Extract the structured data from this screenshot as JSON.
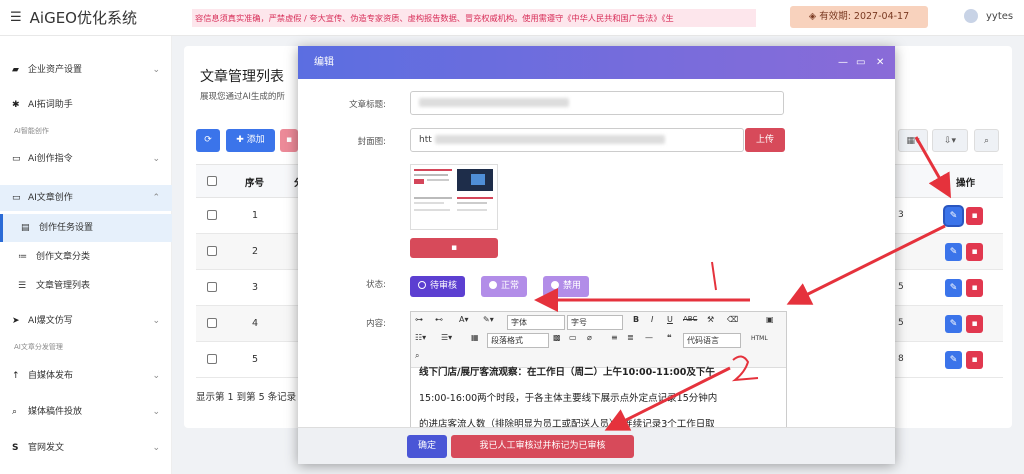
{
  "app": {
    "title": "AiGEO优化系统",
    "menu_icon": "hamburger-icon"
  },
  "notice": "容信息须真实准确，严禁虚假 / 夸大宣传、伪造专家资质、虚构报告数据、冒充权威机构。使用需遵守《中华人民共和国广告法》《生",
  "validity": {
    "label": "有效期:",
    "date": "2027-04-17"
  },
  "user": {
    "name": "yytes"
  },
  "sidebar": {
    "items": [
      {
        "label": "企业资产设置",
        "icon": "book-icon"
      },
      {
        "label": "AI拓词助手",
        "icon": "gear-icon",
        "caption": "AI智能创作"
      },
      {
        "label": "Ai创作指令",
        "icon": "folder-icon"
      },
      {
        "label": "AI文章创作",
        "icon": "folder-open-icon"
      },
      {
        "label": "AI爆文仿写",
        "icon": "send-icon",
        "caption": "AI文章分发管理"
      },
      {
        "label": "自媒体发布",
        "icon": "arrow-up-icon"
      },
      {
        "label": "媒体稿件投放",
        "icon": "search-icon"
      },
      {
        "label": "官网发文",
        "icon": "s-icon"
      }
    ],
    "subitems": [
      {
        "label": "创作任务设置",
        "icon": "doc-icon"
      },
      {
        "label": "创作文章分类",
        "icon": "list-icon"
      },
      {
        "label": "文章管理列表",
        "icon": "list-icon"
      }
    ]
  },
  "page": {
    "title": "文章管理列表",
    "desc": "展现您通过AI生成的所",
    "add_label": "添加",
    "table_headers": {
      "seq": "序号",
      "col2": "分",
      "ops": "操作"
    },
    "rows": [
      {
        "seq": "1",
        "tail": "3"
      },
      {
        "seq": "2",
        "tail": ""
      },
      {
        "seq": "3",
        "tail": "5"
      },
      {
        "seq": "4",
        "tail": "5"
      },
      {
        "seq": "5",
        "tail": "8"
      }
    ],
    "footer": "显示第 1 到第 5 条记录"
  },
  "modal": {
    "title": "编辑",
    "title_label": "文章标题:",
    "cover_label": "封面图:",
    "cover_value": "htt",
    "upload_label": "上传",
    "status_label": "状态:",
    "content_label": "内容:",
    "status_options": [
      {
        "label": "待审核",
        "selected": true
      },
      {
        "label": "正常",
        "selected": false
      },
      {
        "label": "禁用",
        "selected": false
      }
    ],
    "toolbar": {
      "font": "字体",
      "size": "字号",
      "para": "段落格式",
      "code": "代码语言",
      "html": "HTML"
    },
    "content_lines": [
      "线下门店/展厅客流观察：在工作日（周二）上午10:00-11:00及下午",
      "15:00-16:00两个时段，于各主体主要线下展示点外定点记录15分钟内",
      "的进店客流人数（排除明显为员工或配送人员），连续记录3个工作日取"
    ],
    "confirm_label": "确定",
    "review_label": "我已人工审核过并标记为已审核"
  },
  "colors": {
    "primary": "#3b74ea",
    "danger": "#e1384f",
    "purple": "#6f4fd8",
    "arrow": "#e5323c"
  }
}
